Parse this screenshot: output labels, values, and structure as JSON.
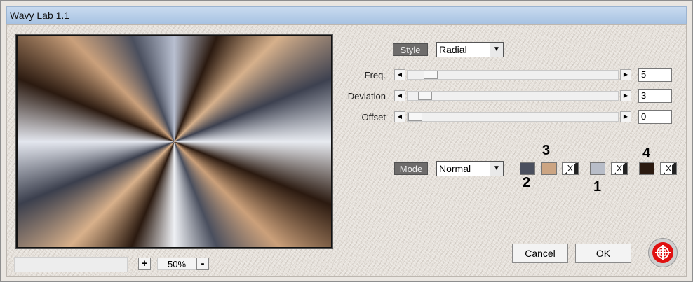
{
  "window": {
    "title": "Wavy Lab 1.1"
  },
  "preview": {
    "zoom_in": "+",
    "zoom_out": "-",
    "zoom": "50%"
  },
  "style": {
    "label": "Style",
    "value": "Radial"
  },
  "sliders": [
    {
      "label": "Freq.",
      "value": "5",
      "position": 0.08
    },
    {
      "label": "Deviation",
      "value": "3",
      "position": 0.05
    },
    {
      "label": "Offset",
      "value": "0",
      "position": 0.0
    }
  ],
  "mode": {
    "label": "Mode",
    "value": "Normal"
  },
  "colors": {
    "c2": "#4a4f5e",
    "c3": "#cca583",
    "c1": "#b8bdc8",
    "c4": "#2b1a10"
  },
  "annotations": {
    "n1": "1",
    "n2": "2",
    "n3": "3",
    "n4": "4"
  },
  "swap_glyph": "X",
  "buttons": {
    "cancel": "Cancel",
    "ok": "OK"
  }
}
